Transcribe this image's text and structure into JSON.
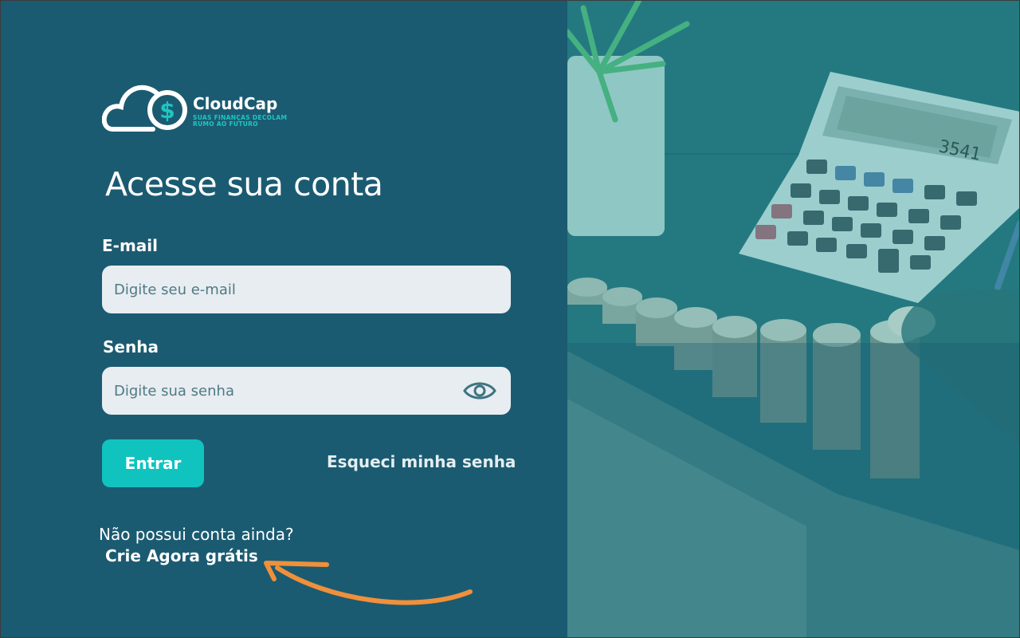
{
  "brand": {
    "name": "CloudCap",
    "tagline_line1": "SUAS FINANÇAS DECOLAM",
    "tagline_line2": "RUMO AO FUTURO",
    "logo_icon": "cloud-dollar-icon"
  },
  "login": {
    "title": "Acesse sua conta",
    "email_label": "E-mail",
    "email_placeholder": "Digite seu e-mail",
    "email_value": "",
    "password_label": "Senha",
    "password_placeholder": "Digite sua senha",
    "password_value": "",
    "show_password_icon": "eye-icon",
    "submit_label": "Entrar",
    "forgot_label": "Esqueci minha senha",
    "no_account_text": "Não possui conta ainda?",
    "create_label": "Crie Agora grátis"
  },
  "photo": {
    "calculator_display": "3541"
  },
  "colors": {
    "panel_bg": "#1b5b71",
    "accent": "#10c3bf",
    "input_bg": "#e8edf1",
    "arrow": "#f0903a"
  }
}
